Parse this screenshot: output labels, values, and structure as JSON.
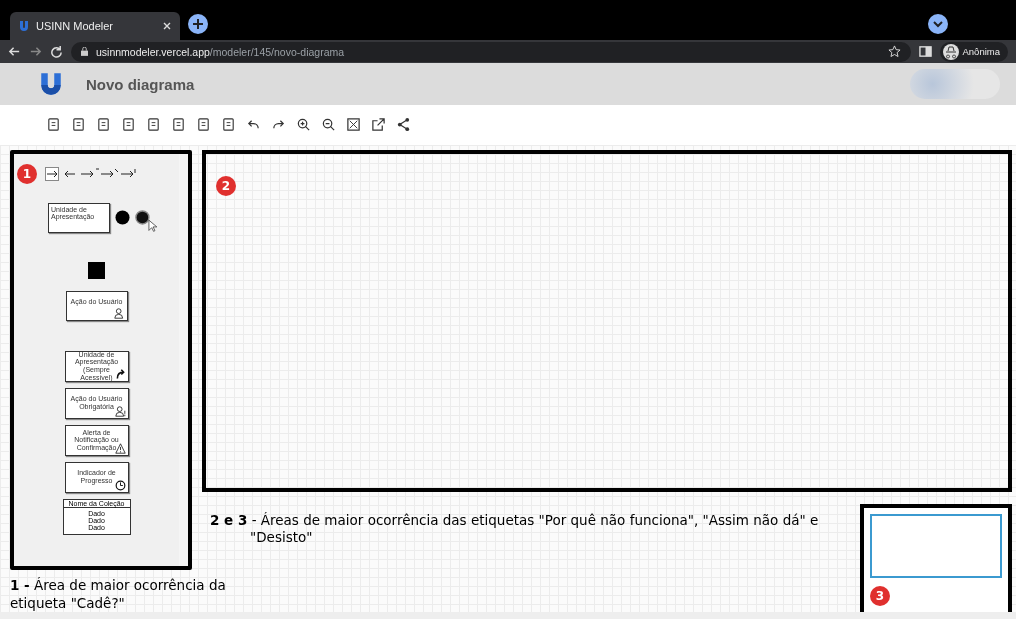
{
  "browser": {
    "tabs": [
      {
        "label": "USINN Modeler",
        "selected": true
      }
    ],
    "address": {
      "host": "usinnmodeler.vercel.app",
      "path": "/modeler/145/novo-diagrama"
    },
    "profile": {
      "label": "Anônima"
    }
  },
  "app": {
    "title": "Novo diagrama"
  },
  "palette": {
    "marker": "1",
    "items": [
      {
        "kind": "unit",
        "label": "Unidade de Apresentação"
      },
      {
        "kind": "end"
      },
      {
        "kind": "action",
        "label": "Ação do Usuário"
      },
      {
        "kind": "unit-accessible",
        "label": "Unidade de Apresentação (Sempre Acessível)"
      },
      {
        "kind": "action-required",
        "label": "Ação do Usuário Obrigatória"
      },
      {
        "kind": "alert",
        "label": "Alerta de Notificação ou Confirmação"
      },
      {
        "kind": "progress",
        "label": "Indicador de Progresso"
      },
      {
        "kind": "collection",
        "label": "Nome da Coleção",
        "rows": [
          "Dado",
          "Dado",
          "Dado"
        ]
      }
    ]
  },
  "canvas": {
    "marker": "2"
  },
  "minimap": {
    "marker": "3"
  },
  "annotations": [
    {
      "text": "**1 -** Área de maior ocorrência da etiqueta \"Cadê?\""
    },
    {
      "text": "**2 e 3** - Áreas de maior ocorrência das etiquetas \"Por quê não funciona\", \"Assim não dá\" e \"Desisto\""
    }
  ]
}
